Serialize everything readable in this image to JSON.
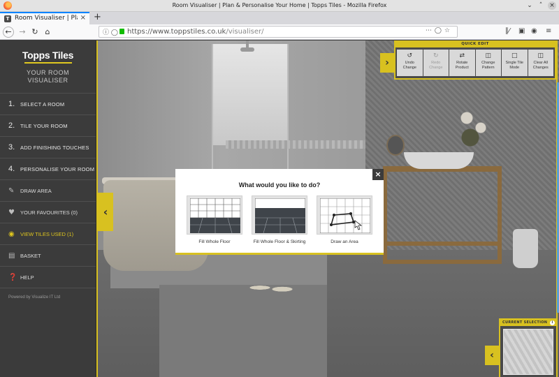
{
  "browser": {
    "window_title": "Room Visualiser | Plan & Personalise Your Home | Topps Tiles - Mozilla Firefox",
    "tab_title": "Room Visualiser | Pla",
    "url_host": "https://www.toppstiles.co.uk",
    "url_path": "/visualiser/"
  },
  "brand": {
    "logo": "Topps Tiles",
    "subtitle_line1": "YOUR ROOM",
    "subtitle_line2": "VISUALISER"
  },
  "steps": [
    {
      "num": "1.",
      "label": "SELECT A ROOM"
    },
    {
      "num": "2.",
      "label": "TILE YOUR ROOM"
    },
    {
      "num": "3.",
      "label": "ADD FINISHING TOUCHES"
    },
    {
      "num": "4.",
      "label": "PERSONALISE YOUR ROOM"
    }
  ],
  "menu": [
    {
      "icon": "pencil-icon",
      "label": "DRAW AREA"
    },
    {
      "icon": "heart-icon",
      "label": "YOUR FAVOURITES (0)"
    },
    {
      "icon": "eye-icon",
      "label": "VIEW TILES USED (1)"
    },
    {
      "icon": "basket-icon",
      "label": "BASKET"
    },
    {
      "icon": "help-icon",
      "label": "HELP"
    }
  ],
  "powered_by": "Powered by Visualize IT Ltd",
  "quick_edit": {
    "title": "QUICK EDIT",
    "buttons": [
      {
        "line1": "Undo",
        "line2": "Change",
        "enabled": true
      },
      {
        "line1": "Redo",
        "line2": "Change",
        "enabled": false
      },
      {
        "line1": "Rotate",
        "line2": "Product",
        "enabled": true
      },
      {
        "line1": "Change",
        "line2": "Pattern",
        "enabled": true
      },
      {
        "line1": "Single Tile",
        "line2": "Mode",
        "enabled": true
      },
      {
        "line1": "Clear All",
        "line2": "Changes",
        "enabled": true
      }
    ]
  },
  "current_selection": {
    "title": "CURRENT SELECTION"
  },
  "modal": {
    "title": "What would you like to do?",
    "options": [
      {
        "label": "Fill Whole Floor"
      },
      {
        "label": "Fill Whole Floor & Skirting"
      },
      {
        "label": "Draw an Area"
      }
    ]
  },
  "colors": {
    "accent": "#d8c120",
    "sidebar_bg": "#3b3b3b"
  }
}
